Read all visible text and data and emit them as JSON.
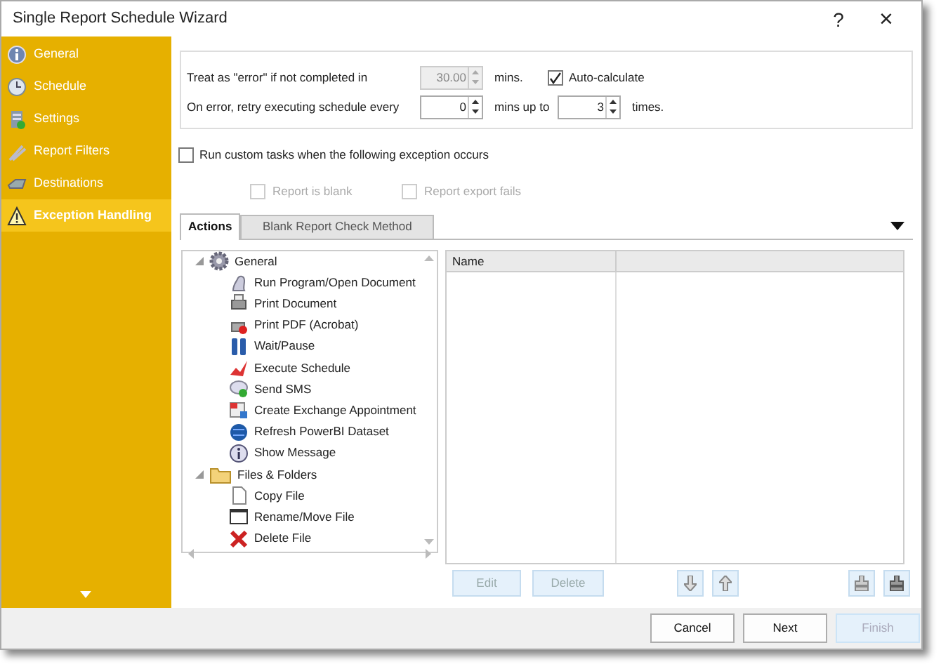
{
  "window": {
    "title": "Single Report Schedule Wizard",
    "help": "?",
    "close": "×"
  },
  "sidebar": {
    "items": [
      {
        "label": "General",
        "selected": false
      },
      {
        "label": "Schedule",
        "selected": false
      },
      {
        "label": "Settings",
        "selected": false
      },
      {
        "label": "Report Filters",
        "selected": false
      },
      {
        "label": "Destinations",
        "selected": false
      },
      {
        "label": "Exception Handling",
        "selected": true
      }
    ]
  },
  "timeout": {
    "label": "Treat as \"error\" if not completed in",
    "value": "30.00",
    "disabled": true,
    "unit": "mins.",
    "auto_calculate": {
      "label": "Auto-calculate",
      "checked": true
    }
  },
  "retry": {
    "label": "On error, retry  executing schedule every",
    "value": "0",
    "unit": "mins up to",
    "times_value": "3",
    "times_unit": "times."
  },
  "custom_tasks": {
    "label": "Run custom tasks when the following exception occurs",
    "checked": false,
    "exceptions": [
      {
        "label": "Report is blank",
        "checked": false,
        "disabled": true
      },
      {
        "label": "Report export fails",
        "checked": false,
        "disabled": true
      }
    ]
  },
  "tabs": [
    {
      "label": "Actions",
      "selected": true
    },
    {
      "label": "Blank Report Check Method",
      "selected": false
    }
  ],
  "action_tree": [
    {
      "label": "General",
      "expanded": true,
      "children": [
        {
          "label": "Run Program/Open Document"
        },
        {
          "label": "Print Document"
        },
        {
          "label": "Print PDF (Acrobat)"
        },
        {
          "label": "Wait/Pause"
        },
        {
          "label": "Execute Schedule"
        },
        {
          "label": "Send SMS"
        },
        {
          "label": "Create Exchange Appointment"
        },
        {
          "label": "Refresh PowerBI Dataset"
        },
        {
          "label": "Show Message"
        }
      ]
    },
    {
      "label": "Files & Folders",
      "expanded": true,
      "children": [
        {
          "label": "Copy File"
        },
        {
          "label": "Rename/Move File"
        },
        {
          "label": "Delete File"
        }
      ]
    }
  ],
  "task_list": {
    "columns": [
      "Name"
    ]
  },
  "task_buttons": [
    {
      "label": "Edit",
      "disabled": true
    },
    {
      "label": "Delete",
      "disabled": true
    }
  ],
  "footer_buttons": [
    {
      "label": "Cancel",
      "disabled": false
    },
    {
      "label": "Next",
      "disabled": false
    },
    {
      "label": "Finish",
      "disabled": true
    }
  ]
}
